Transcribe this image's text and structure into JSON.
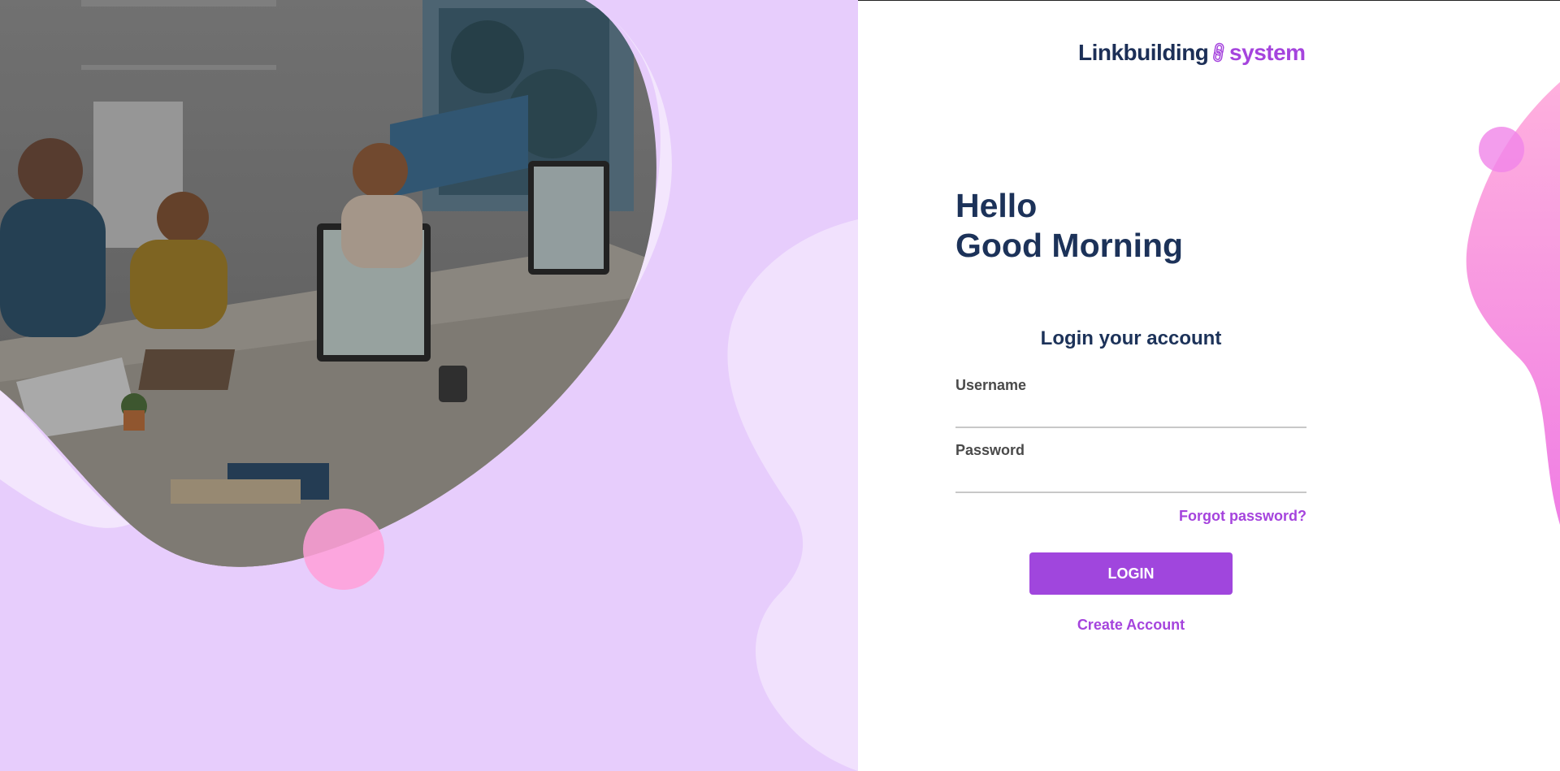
{
  "brand": {
    "name_part1": "Linkbuilding",
    "name_part2": "system",
    "link_icon": "link-icon"
  },
  "hero": {
    "image_alt": "office-workers-photo"
  },
  "greeting": {
    "line1": "Hello",
    "line2": "Good Morning"
  },
  "login": {
    "title": "Login your account",
    "username_label": "Username",
    "username_value": "",
    "password_label": "Password",
    "password_value": "",
    "forgot_label": "Forgot password?",
    "submit_label": "LOGIN",
    "create_label": "Create Account"
  },
  "colors": {
    "primary": "#a046dd",
    "heading": "#1c3259",
    "left_bg": "#e7cdfc",
    "accent_pink": "#ff9fd8"
  }
}
